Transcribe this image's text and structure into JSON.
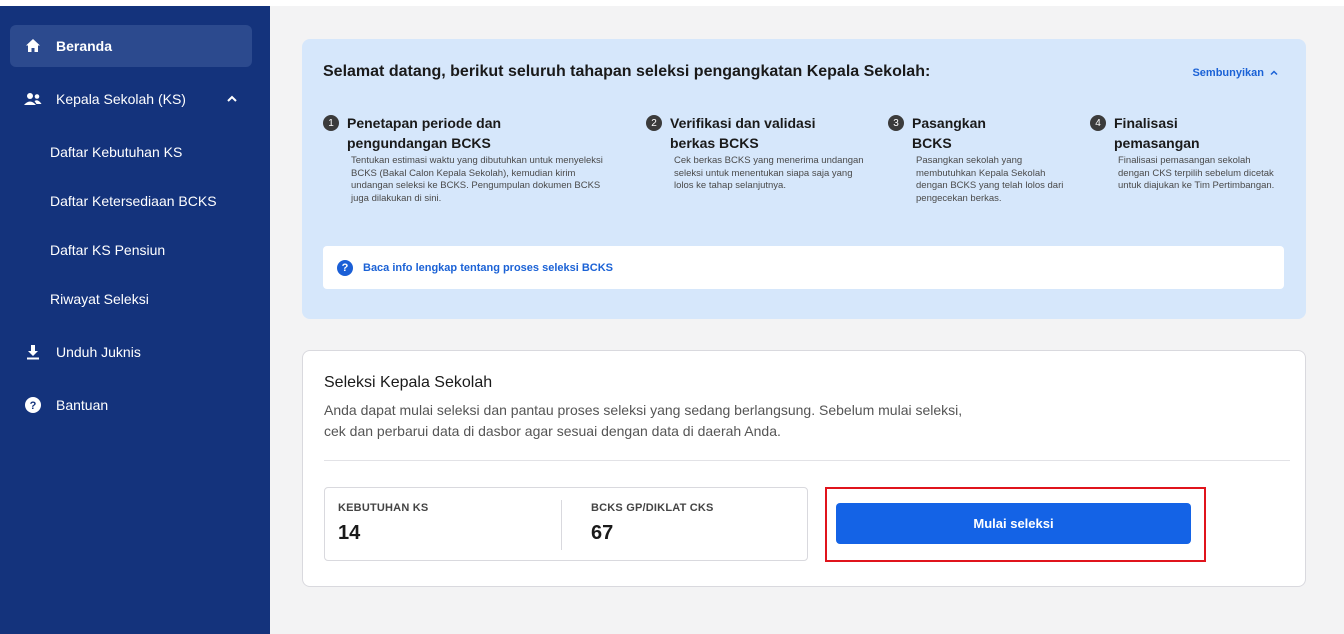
{
  "sidebar": {
    "items": [
      {
        "label": "Beranda",
        "icon": "home-icon"
      },
      {
        "label": "Kepala Sekolah (KS)",
        "icon": "users-icon"
      },
      {
        "label": "Daftar Kebutuhan KS"
      },
      {
        "label": "Daftar Ketersediaan BCKS"
      },
      {
        "label": "Daftar KS Pensiun"
      },
      {
        "label": "Riwayat Seleksi"
      },
      {
        "label": "Unduh Juknis",
        "icon": "download-icon"
      },
      {
        "label": "Bantuan",
        "icon": "help-icon"
      }
    ]
  },
  "info": {
    "title": "Selamat datang, berikut seluruh tahapan seleksi pengangkatan Kepala Sekolah:",
    "hide_label": "Sembunyikan",
    "steps": [
      {
        "num": "1",
        "title": "Penetapan periode dan pengundangan BCKS",
        "desc": "Tentukan estimasi waktu yang dibutuhkan untuk menyeleksi BCKS (Bakal Calon Kepala Sekolah), kemudian kirim undangan seleksi ke BCKS. Pengumpulan dokumen BCKS juga dilakukan di sini."
      },
      {
        "num": "2",
        "title": "Verifikasi dan validasi berkas BCKS",
        "desc": "Cek berkas BCKS yang menerima undangan seleksi untuk menentukan siapa saja yang lolos ke tahap selanjutnya."
      },
      {
        "num": "3",
        "title": "Pasangkan BCKS",
        "desc": "Pasangkan sekolah yang membutuhkan Kepala Sekolah dengan BCKS yang telah lolos dari pengecekan berkas."
      },
      {
        "num": "4",
        "title": "Finalisasi pemasangan",
        "desc": "Finalisasi pemasangan sekolah dengan CKS terpilih sebelum dicetak untuk diajukan ke Tim Pertimbangan."
      }
    ],
    "link_text": "Baca info lengkap tentang proses seleksi BCKS"
  },
  "card": {
    "title": "Seleksi Kepala Sekolah",
    "desc": "Anda dapat mulai seleksi dan pantau proses seleksi yang sedang berlangsung. Sebelum mulai seleksi, cek dan perbarui data di dasbor agar sesuai dengan data di daerah Anda.",
    "stats": [
      {
        "label": "KEBUTUHAN KS",
        "value": "14"
      },
      {
        "label": "BCKS GP/DIKLAT CKS",
        "value": "67"
      }
    ],
    "button_label": "Mulai seleksi"
  },
  "colors": {
    "sidebar_bg": "#14337c",
    "primary": "#1463e6",
    "info_bg": "#d6e7fb",
    "highlight": "#e0141c"
  }
}
